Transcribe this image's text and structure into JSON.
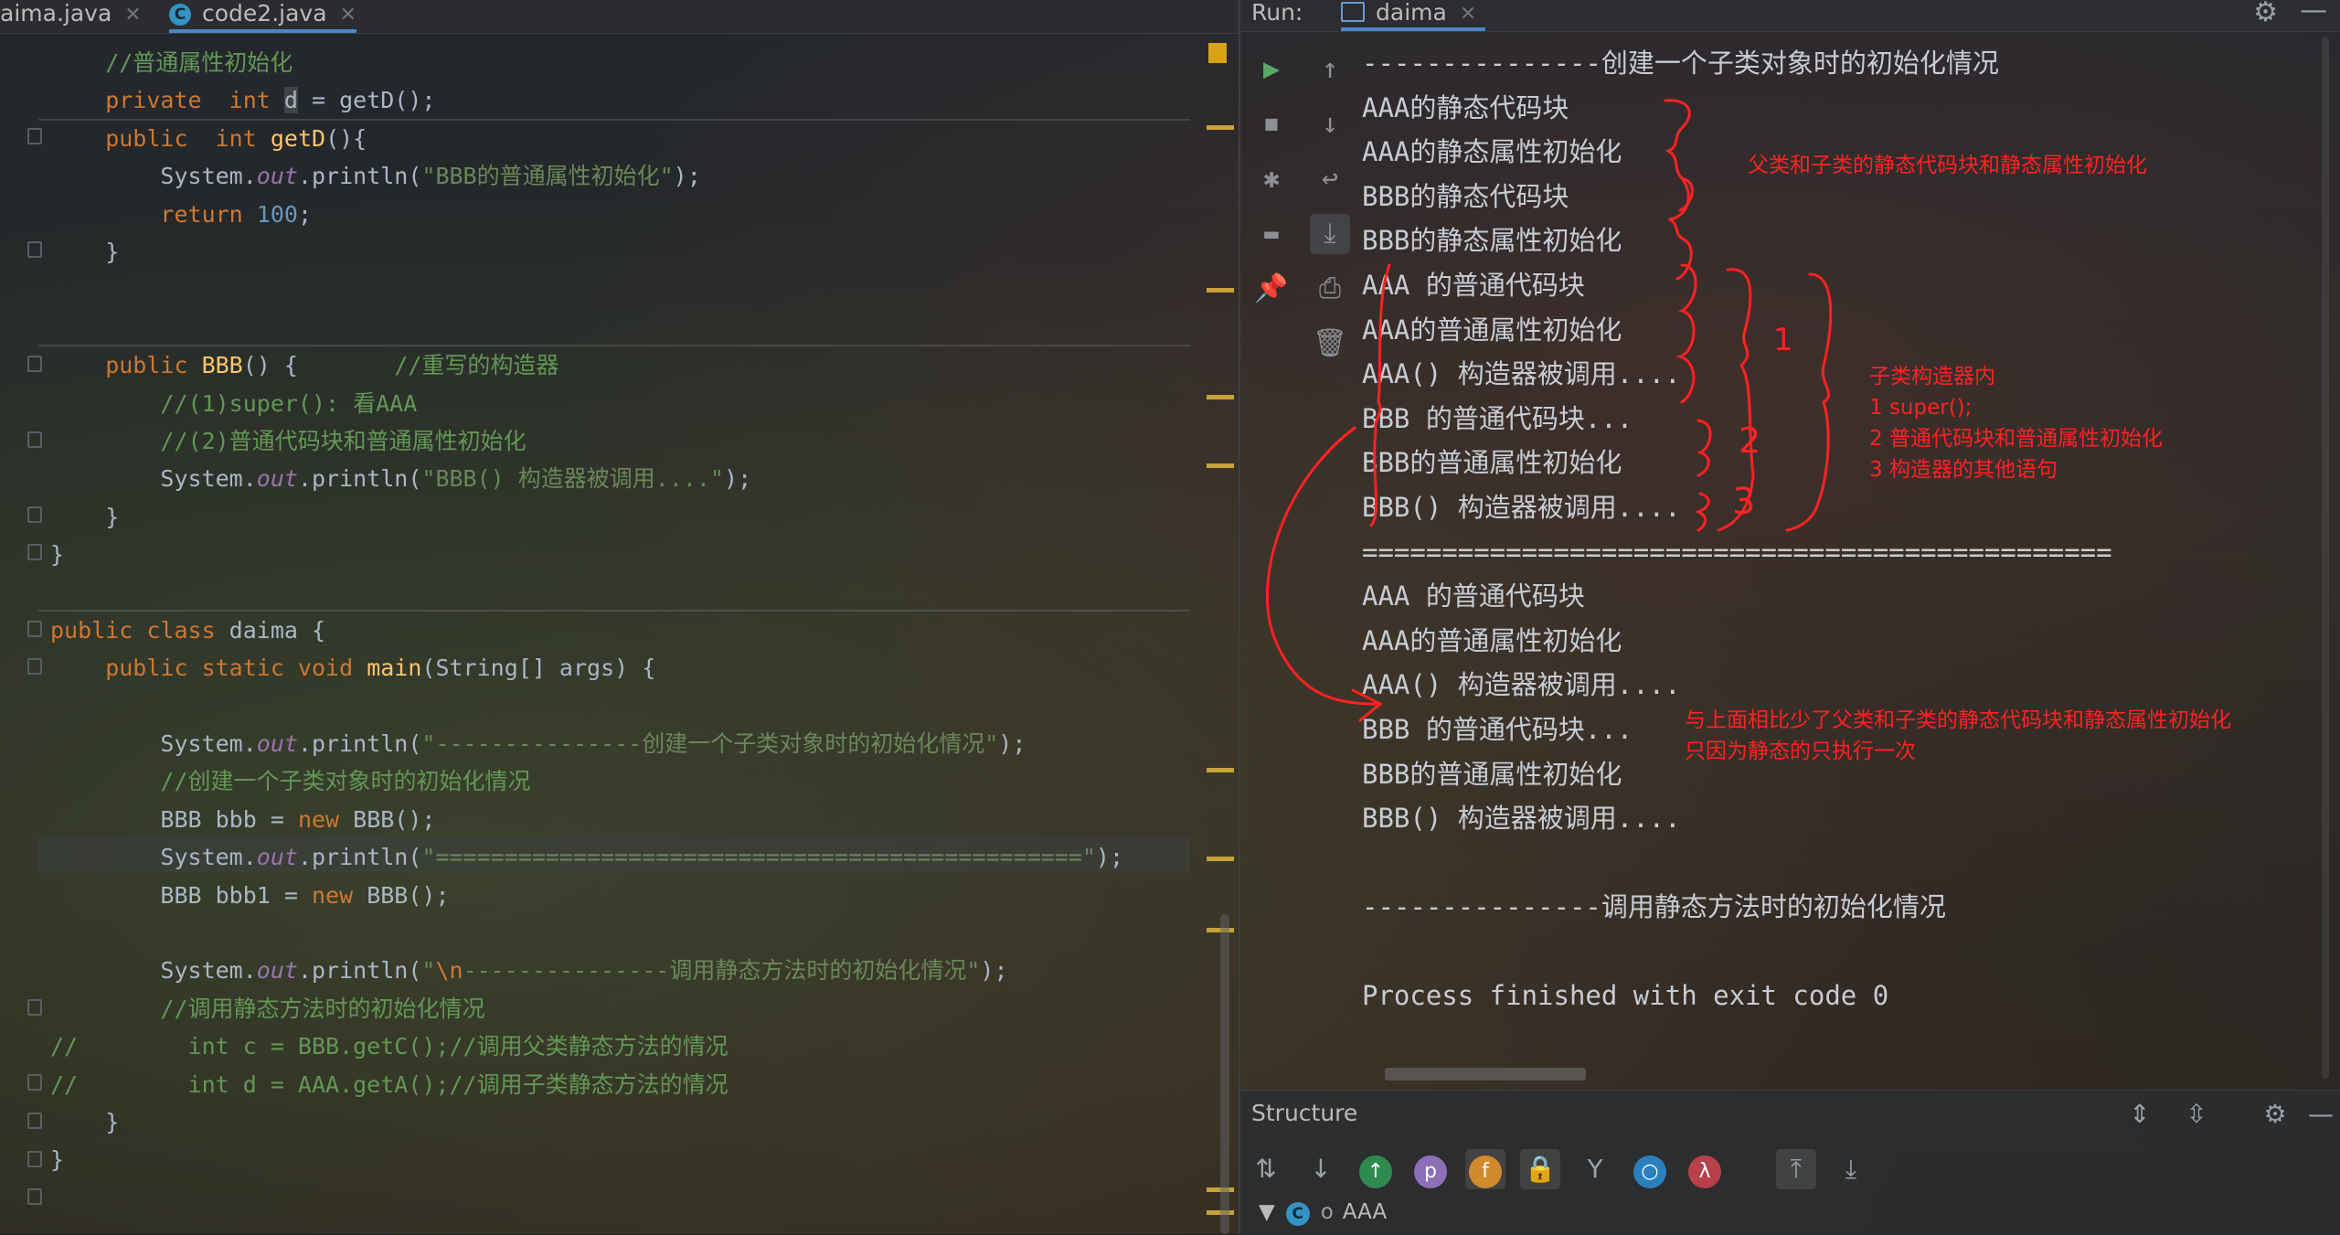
{
  "editor": {
    "tabs": [
      {
        "label": "aima.java"
      },
      {
        "label": "code2.java"
      }
    ],
    "lines": [
      {
        "parts": [
          {
            "t": "    //普通属性初始化",
            "c": "cm"
          }
        ]
      },
      {
        "parts": [
          {
            "t": "    private  ",
            "c": "kw"
          },
          {
            "t": "int ",
            "c": "kw"
          },
          {
            "t": "d",
            "c": "caret-c"
          },
          {
            "t": " = getD();",
            "c": "wt"
          }
        ]
      },
      {
        "parts": [
          {
            "t": "    public  ",
            "c": "kw"
          },
          {
            "t": "int ",
            "c": "kw"
          },
          {
            "t": "getD",
            "c": "fn"
          },
          {
            "t": "(){",
            "c": "wt"
          }
        ]
      },
      {
        "parts": [
          {
            "t": "        System.",
            "c": "wt"
          },
          {
            "t": "out",
            "c": "it"
          },
          {
            "t": ".println(",
            "c": "wt"
          },
          {
            "t": "\"BBB的普通属性初始化\"",
            "c": "st"
          },
          {
            "t": ");",
            "c": "wt"
          }
        ]
      },
      {
        "parts": [
          {
            "t": "        return ",
            "c": "kw"
          },
          {
            "t": "100",
            "c": "nm"
          },
          {
            "t": ";",
            "c": "wt"
          }
        ]
      },
      {
        "parts": [
          {
            "t": "    }",
            "c": "wt"
          }
        ]
      },
      {
        "parts": [
          {
            "t": "",
            "c": "wt"
          }
        ]
      },
      {
        "parts": [
          {
            "t": "",
            "c": "wt"
          }
        ]
      },
      {
        "parts": [
          {
            "t": "    public ",
            "c": "kw"
          },
          {
            "t": "BBB",
            "c": "fn"
          },
          {
            "t": "() {       ",
            "c": "wt"
          },
          {
            "t": "//重写的构造器",
            "c": "cm"
          }
        ]
      },
      {
        "parts": [
          {
            "t": "        //(1)super(): 看AAA",
            "c": "cm"
          }
        ]
      },
      {
        "parts": [
          {
            "t": "        //(2)普通代码块和普通属性初始化",
            "c": "cm"
          }
        ]
      },
      {
        "parts": [
          {
            "t": "        System.",
            "c": "wt"
          },
          {
            "t": "out",
            "c": "it"
          },
          {
            "t": ".println(",
            "c": "wt"
          },
          {
            "t": "\"BBB() 构造器被调用....\"",
            "c": "st"
          },
          {
            "t": ");",
            "c": "wt"
          }
        ]
      },
      {
        "parts": [
          {
            "t": "    }",
            "c": "wt"
          }
        ]
      },
      {
        "parts": [
          {
            "t": "}",
            "c": "wt"
          }
        ]
      },
      {
        "parts": [
          {
            "t": "",
            "c": "wt"
          }
        ]
      },
      {
        "parts": [
          {
            "t": "public class ",
            "c": "kw"
          },
          {
            "t": "daima {",
            "c": "wt"
          }
        ]
      },
      {
        "parts": [
          {
            "t": "    public static void ",
            "c": "kw"
          },
          {
            "t": "main",
            "c": "fn"
          },
          {
            "t": "(String[] args) {",
            "c": "wt"
          }
        ]
      },
      {
        "parts": [
          {
            "t": "",
            "c": "wt"
          }
        ]
      },
      {
        "parts": [
          {
            "t": "        System.",
            "c": "wt"
          },
          {
            "t": "out",
            "c": "it"
          },
          {
            "t": ".println(",
            "c": "wt"
          },
          {
            "t": "\"---------------创建一个子类对象时的初始化情况\"",
            "c": "st"
          },
          {
            "t": ");",
            "c": "wt"
          }
        ]
      },
      {
        "parts": [
          {
            "t": "        //创建一个子类对象时的初始化情况",
            "c": "cm"
          }
        ]
      },
      {
        "parts": [
          {
            "t": "        BBB bbb = ",
            "c": "wt"
          },
          {
            "t": "new ",
            "c": "kw"
          },
          {
            "t": "BBB();",
            "c": "wt"
          }
        ]
      },
      {
        "parts": [
          {
            "t": "        System.",
            "c": "wt"
          },
          {
            "t": "out",
            "c": "it"
          },
          {
            "t": ".println(",
            "c": "wt"
          },
          {
            "t": "\"===============================================\"",
            "c": "st"
          },
          {
            "t": ");",
            "c": "wt"
          }
        ]
      },
      {
        "parts": [
          {
            "t": "        BBB bbb1 = ",
            "c": "wt"
          },
          {
            "t": "new ",
            "c": "kw"
          },
          {
            "t": "BBB();",
            "c": "wt"
          }
        ]
      },
      {
        "parts": [
          {
            "t": "",
            "c": "wt"
          }
        ]
      },
      {
        "parts": [
          {
            "t": "        System.",
            "c": "wt"
          },
          {
            "t": "out",
            "c": "it"
          },
          {
            "t": ".println(",
            "c": "wt"
          },
          {
            "t": "\"",
            "c": "st"
          },
          {
            "t": "\\n",
            "c": "es"
          },
          {
            "t": "---------------调用静态方法时的初始化情况\"",
            "c": "st"
          },
          {
            "t": ");",
            "c": "wt"
          }
        ]
      },
      {
        "parts": [
          {
            "t": "        //调用静态方法时的初始化情况",
            "c": "cm"
          }
        ]
      },
      {
        "parts": [
          {
            "t": "//        int c = BBB.getC();//调用父类静态方法的情况",
            "c": "cm"
          }
        ]
      },
      {
        "parts": [
          {
            "t": "//        int d = AAA.getA();//调用子类静态方法的情况",
            "c": "cm"
          }
        ]
      },
      {
        "parts": [
          {
            "t": "    }",
            "c": "wt"
          }
        ]
      },
      {
        "parts": [
          {
            "t": "}",
            "c": "wt"
          }
        ]
      }
    ]
  },
  "run": {
    "label": "Run:",
    "tab": "daima",
    "output": [
      "---------------创建一个子类对象时的初始化情况",
      "AAA的静态代码块",
      "AAA的静态属性初始化",
      "BBB的静态代码块",
      "BBB的静态属性初始化",
      "AAA 的普通代码块",
      "AAA的普通属性初始化",
      "AAA() 构造器被调用....",
      "BBB 的普通代码块...",
      "BBB的普通属性初始化",
      "BBB() 构造器被调用....",
      "===============================================",
      "AAA 的普通代码块",
      "AAA的普通属性初始化",
      "AAA() 构造器被调用....",
      "BBB 的普通代码块...",
      "BBB的普通属性初始化",
      "BBB() 构造器被调用....",
      "",
      "---------------调用静态方法时的初始化情况",
      "",
      "Process finished with exit code 0"
    ],
    "annotations": {
      "static_note": "父类和子类的静态代码块和静态属性初始化",
      "ctor_note": "子类构造器内\n1 super();\n2 普通代码块和普通属性初始化\n3 构造器的其他语句",
      "second_note": "与上面相比少了父类和子类的静态代码块和静态属性初始化\n只因为静态的只执行一次",
      "num1": "1",
      "num2": "2",
      "num3": "3"
    }
  },
  "structure": {
    "title": "Structure",
    "tree_item": "AAA"
  },
  "colors": {
    "keyword": "#cc7832",
    "function": "#ffc66d",
    "string": "#6a8759",
    "comment": "#629755",
    "annotation_red": "#ff2222"
  }
}
